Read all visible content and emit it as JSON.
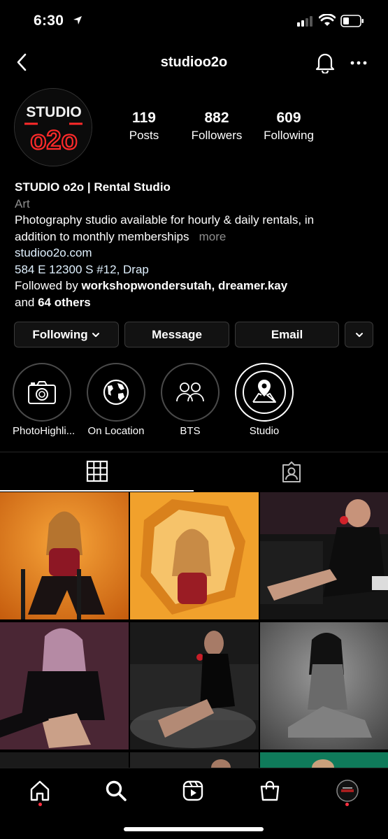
{
  "status_bar": {
    "time": "6:30"
  },
  "header": {
    "username": "studioo2o"
  },
  "avatar": {
    "line1": "STUDIO",
    "line2": "o2o"
  },
  "stats": {
    "posts_count": "119",
    "posts_label": "Posts",
    "followers_count": "882",
    "followers_label": "Followers",
    "following_count": "609",
    "following_label": "Following"
  },
  "bio": {
    "name": "STUDIO o2o | Rental Studio",
    "category": "Art",
    "description_line1": "Photography studio available for hourly & daily rentals, in",
    "description_line2": "addition to monthly memberships",
    "more": "more",
    "website": "studioo2o.com",
    "address": "584 E 12300 S #12, Drap",
    "followed_by_prefix": "Followed by ",
    "followed_by_names": "workshopwondersutah, dreamer.kay",
    "followed_by_and": "and ",
    "followed_by_others": "64 others"
  },
  "actions": {
    "following": "Following",
    "message": "Message",
    "email": "Email"
  },
  "highlights": [
    {
      "label": "PhotoHighli...",
      "icon": "camera-icon"
    },
    {
      "label": "On Location",
      "icon": "globe-icon"
    },
    {
      "label": "BTS",
      "icon": "people-icon"
    },
    {
      "label": "Studio",
      "icon": "map-pin-icon"
    }
  ],
  "tabs": [
    {
      "icon": "grid-icon",
      "active": true
    },
    {
      "icon": "tagged-icon",
      "active": false
    }
  ],
  "bottom_nav": [
    {
      "icon": "home-icon"
    },
    {
      "icon": "search-icon"
    },
    {
      "icon": "reels-icon"
    },
    {
      "icon": "shop-icon"
    },
    {
      "icon": "profile-avatar"
    }
  ],
  "colors": {
    "background": "#000000",
    "button_bg": "#121212",
    "muted_text": "#8e8e8e",
    "link_text": "#e0f1ff",
    "notification_dot": "#ff3040",
    "logo_red": "#ff2a2a"
  }
}
